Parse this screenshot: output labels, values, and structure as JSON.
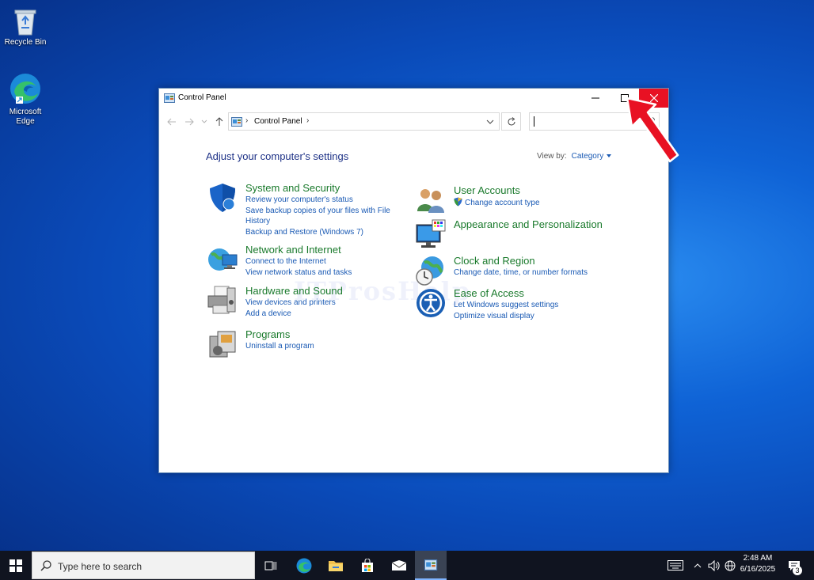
{
  "desktop": {
    "icons": [
      {
        "label": "Recycle Bin",
        "icon": "recycle-bin-icon"
      },
      {
        "label": "Microsoft Edge",
        "icon": "edge-icon"
      }
    ]
  },
  "window": {
    "title": "Control Panel",
    "controls": {
      "minimize": "minimize-icon",
      "maximize": "maximize-icon",
      "close": "close-icon"
    },
    "address": {
      "crumb": "Control Panel"
    },
    "search": {
      "value": "",
      "placeholder": ""
    },
    "heading": "Adjust your computer's settings",
    "view_by": {
      "label": "View by:",
      "value": "Category"
    },
    "watermark": "ITProsHelp",
    "categories_left": [
      {
        "title": "System and Security",
        "icon": "shield-icon",
        "links": [
          "Review your computer's status",
          "Save backup copies of your files with File History",
          "Backup and Restore (Windows 7)"
        ]
      },
      {
        "title": "Network and Internet",
        "icon": "globe-network-icon",
        "links": [
          "Connect to the Internet",
          "View network status and tasks"
        ]
      },
      {
        "title": "Hardware and Sound",
        "icon": "printer-icon",
        "links": [
          "View devices and printers",
          "Add a device"
        ]
      },
      {
        "title": "Programs",
        "icon": "programs-box-icon",
        "links": [
          "Uninstall a program"
        ]
      }
    ],
    "categories_right": [
      {
        "title": "User Accounts",
        "icon": "users-icon",
        "links": [
          "Change account type"
        ]
      },
      {
        "title": "Appearance and Personalization",
        "icon": "monitor-palette-icon",
        "links": []
      },
      {
        "title": "Clock and Region",
        "icon": "clock-globe-icon",
        "links": [
          "Change date, time, or number formats"
        ]
      },
      {
        "title": "Ease of Access",
        "icon": "ease-of-access-icon",
        "links": [
          "Let Windows suggest settings",
          "Optimize visual display"
        ]
      }
    ]
  },
  "taskbar": {
    "search_placeholder": "Type here to search",
    "apps": [
      "task-view-icon",
      "edge-icon",
      "file-explorer-icon",
      "store-icon",
      "mail-icon",
      "control-panel-icon"
    ],
    "clock": {
      "time": "2:48 AM",
      "date": "6/16/2025"
    },
    "notifications": "3"
  },
  "colors": {
    "close_red": "#e81123",
    "link_blue": "#1a5ab4",
    "category_green": "#1a7a2c",
    "taskbar": "#101420"
  }
}
